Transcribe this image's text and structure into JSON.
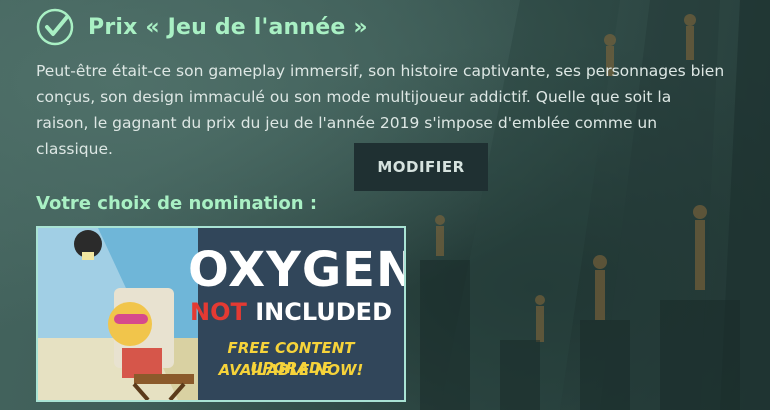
{
  "award": {
    "title": "Prix « Jeu de l'année »",
    "description": "Peut-être était-ce son gameplay immersif, son histoire captivante, ses personnages bien conçus, son design immaculé ou son mode multijoueur addictif. Quelle que soit la raison, le gagnant du prix du jeu de l'année 2019 s'impose d'emblée comme un classique.",
    "modify_label": "MODIFIER"
  },
  "nomination": {
    "label": "Votre choix de nomination :",
    "game": {
      "title_line1": "OXYGEN",
      "title_not": "NOT",
      "title_included": "INCLUDED",
      "subtitle_line1": "FREE CONTENT UPGRADE",
      "subtitle_line2": "AVAILABLE NOW!"
    }
  },
  "colors": {
    "accent": "#a9f0c4",
    "background": "#2f4a46",
    "button": "#1f3032",
    "banner_border": "#a9e3d4"
  },
  "icons": [
    "check-circle-icon"
  ]
}
